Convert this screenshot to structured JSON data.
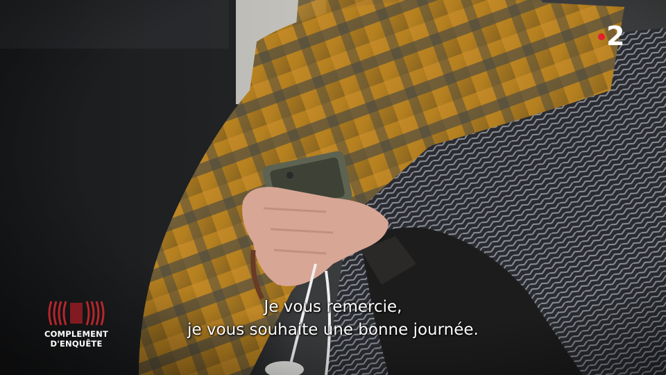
{
  "channel_logo": {
    "number": "2",
    "dot_color": "#e2202f"
  },
  "subtitles": {
    "line1": "Je vous remercie,",
    "line2": "je vous souhaite une bonne journée."
  },
  "show_logo": {
    "line1": "COMPLEMENT",
    "line2": "D'ENQUÊTE",
    "accent_color": "#c0272d"
  }
}
